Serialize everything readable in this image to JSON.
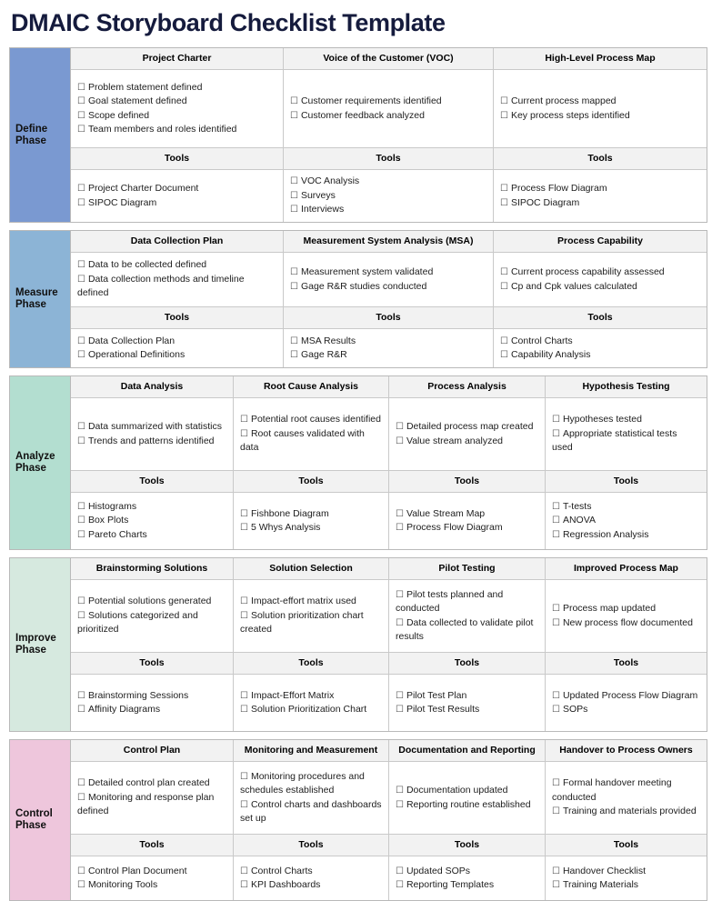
{
  "title": "DMAIC Storyboard Checklist Template",
  "tools_header": "Tools",
  "colors": {
    "title": "#151b3d",
    "header_bg": "#f2f2f2",
    "border": "#c9c9c9",
    "define": "#7a99d1",
    "measure": "#8cb4d6",
    "analyze": "#b3ded0",
    "improve": "#d6e9df",
    "control": "#eec6dc"
  },
  "phases": [
    {
      "name_line1": "Define",
      "name_line2": "Phase",
      "color": "#7a99d1",
      "columns": [
        {
          "header": "Project Charter",
          "items": [
            "Problem statement defined",
            "Goal statement defined",
            "Scope defined",
            "Team members and roles identified"
          ],
          "tools": [
            "Project Charter Document",
            "SIPOC Diagram"
          ]
        },
        {
          "header": "Voice of the Customer (VOC)",
          "items": [
            "Customer requirements identified",
            "Customer feedback analyzed"
          ],
          "tools": [
            "VOC Analysis",
            "Surveys",
            "Interviews"
          ]
        },
        {
          "header": "High-Level Process Map",
          "items": [
            "Current process mapped",
            "Key process steps identified"
          ],
          "tools": [
            "Process Flow Diagram",
            "SIPOC Diagram"
          ]
        }
      ]
    },
    {
      "name_line1": "Measure",
      "name_line2": "Phase",
      "color": "#8cb4d6",
      "columns": [
        {
          "header": "Data Collection Plan",
          "items": [
            "Data to be collected defined",
            "Data collection methods and timeline defined"
          ],
          "tools": [
            "Data Collection Plan",
            "Operational Definitions"
          ]
        },
        {
          "header": "Measurement System Analysis (MSA)",
          "items": [
            "Measurement system validated",
            "Gage R&R studies conducted"
          ],
          "tools": [
            "MSA Results",
            "Gage R&R"
          ]
        },
        {
          "header": "Process Capability",
          "items": [
            "Current process capability assessed",
            "Cp and Cpk values calculated"
          ],
          "tools": [
            "Control Charts",
            "Capability Analysis"
          ]
        }
      ]
    },
    {
      "name_line1": "Analyze",
      "name_line2": "Phase",
      "color": "#b3ded0",
      "columns": [
        {
          "header": "Data Analysis",
          "items": [
            "Data summarized with statistics",
            "Trends and patterns identified"
          ],
          "tools": [
            "Histograms",
            "Box Plots",
            "Pareto Charts"
          ]
        },
        {
          "header": "Root Cause Analysis",
          "items": [
            "Potential root causes identified",
            "Root causes validated with data"
          ],
          "tools": [
            "Fishbone Diagram",
            "5 Whys Analysis"
          ]
        },
        {
          "header": "Process Analysis",
          "items": [
            "Detailed process map created",
            "Value stream analyzed"
          ],
          "tools": [
            "Value Stream Map",
            "Process Flow Diagram"
          ]
        },
        {
          "header": "Hypothesis Testing",
          "items": [
            "Hypotheses tested",
            "Appropriate statistical tests used"
          ],
          "tools": [
            "T-tests",
            "ANOVA",
            "Regression Analysis"
          ]
        }
      ]
    },
    {
      "name_line1": "Improve",
      "name_line2": "Phase",
      "color": "#d6e9df",
      "columns": [
        {
          "header": "Brainstorming Solutions",
          "items": [
            "Potential solutions generated",
            "Solutions categorized and prioritized"
          ],
          "tools": [
            "Brainstorming Sessions",
            "Affinity Diagrams"
          ]
        },
        {
          "header": "Solution Selection",
          "items": [
            "Impact-effort matrix used",
            "Solution prioritization chart created"
          ],
          "tools": [
            "Impact-Effort Matrix",
            "Solution Prioritization Chart"
          ]
        },
        {
          "header": "Pilot Testing",
          "items": [
            "Pilot tests planned and conducted",
            "Data collected to validate pilot results"
          ],
          "tools": [
            "Pilot Test Plan",
            "Pilot Test Results"
          ]
        },
        {
          "header": "Improved Process Map",
          "items": [
            "Process map updated",
            "New process flow documented"
          ],
          "tools": [
            "Updated Process Flow Diagram",
            "SOPs"
          ]
        }
      ]
    },
    {
      "name_line1": "Control",
      "name_line2": "Phase",
      "color": "#eec6dc",
      "columns": [
        {
          "header": "Control Plan",
          "items": [
            "Detailed control plan created",
            "Monitoring and response plan defined"
          ],
          "tools": [
            "Control Plan Document",
            "Monitoring Tools"
          ]
        },
        {
          "header": "Monitoring and Measurement",
          "items": [
            "Monitoring procedures and schedules established",
            "Control charts and dashboards set up"
          ],
          "tools": [
            "Control Charts",
            "KPI Dashboards"
          ]
        },
        {
          "header": "Documentation and Reporting",
          "items": [
            "Documentation updated",
            "Reporting routine established"
          ],
          "tools": [
            "Updated SOPs",
            "Reporting Templates"
          ]
        },
        {
          "header": "Handover to Process Owners",
          "items": [
            "Formal handover meeting conducted",
            "Training and materials provided"
          ],
          "tools": [
            "Handover Checklist",
            "Training Materials"
          ]
        }
      ]
    }
  ]
}
